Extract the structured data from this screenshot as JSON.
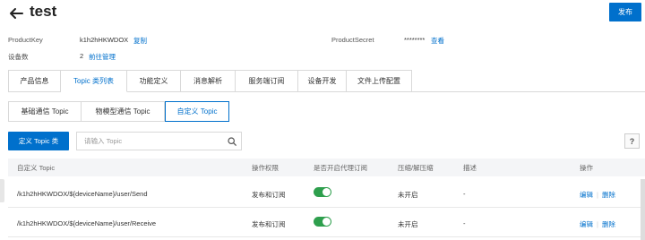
{
  "header": {
    "title": "test",
    "publish_label": "发布"
  },
  "meta": {
    "product_key_label": "ProductKey",
    "product_key_value": "k1h2hHKWDOX",
    "copy_label": "复制",
    "product_secret_label": "ProductSecret",
    "product_secret_value": "********",
    "view_label": "查看",
    "device_count_label": "设备数",
    "device_count_value": "2",
    "goto_manage_label": "前往管理"
  },
  "tabs": [
    {
      "label": "产品信息"
    },
    {
      "label": "Topic 类列表"
    },
    {
      "label": "功能定义"
    },
    {
      "label": "消息解析"
    },
    {
      "label": "服务端订阅"
    },
    {
      "label": "设备开发"
    },
    {
      "label": "文件上传配置"
    }
  ],
  "subtabs": [
    {
      "label": "基础通信 Topic"
    },
    {
      "label": "物模型通信 Topic"
    },
    {
      "label": "自定义 Topic"
    }
  ],
  "toolbar": {
    "define_label": "定义 Topic 类",
    "search_placeholder": "请输入 Topic",
    "help_label": "?"
  },
  "table": {
    "columns": [
      "自定义 Topic",
      "操作权限",
      "是否开启代理订阅",
      "压缩/解压缩",
      "描述",
      "操作"
    ],
    "rows": [
      {
        "topic": "/k1h2hHKWDOX/${deviceName}/user/Send",
        "permission": "发布和订阅",
        "proxy_subscribe": true,
        "compression": "未开启",
        "description": "-",
        "edit": "编辑",
        "delete": "删除"
      },
      {
        "topic": "/k1h2hHKWDOX/${deviceName}/user/Receive",
        "permission": "发布和订阅",
        "proxy_subscribe": true,
        "compression": "未开启",
        "description": "-",
        "edit": "编辑",
        "delete": "删除"
      }
    ]
  },
  "colors": {
    "accent": "#0070cc",
    "toggle_on": "#2e9f4d"
  }
}
